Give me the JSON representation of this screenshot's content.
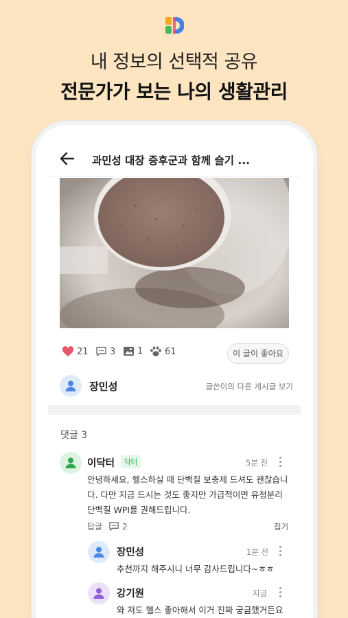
{
  "headline": {
    "line1": "내 정보의 선택적 공유",
    "line2": "전문가가 보는 나의 생활관리"
  },
  "topbar": {
    "title": "과민성 대장 증후군과 함께 슬기 ..."
  },
  "stats": {
    "likes": "21",
    "comments": "3",
    "images": "1",
    "paws": "61"
  },
  "like_post_button": "이 글이 좋아요",
  "author": {
    "name": "장민성",
    "more_posts_link": "글쓴이의 다른 게시글 보기"
  },
  "comments_header": "댓글 3",
  "comments": [
    {
      "name": "이닥터",
      "badge": "닥터",
      "time": "5분 전",
      "lines": [
        "안녕하세요, 헬스하실 때 단백질 보충제 드셔도 괜찮습니",
        "다. 다만 지금 드시는 것도 좋지만 가급적이면 유청분리",
        "단백질 WPI를 권해드립니다."
      ],
      "reply_label": "답글",
      "reply_count": "2",
      "fold_label": "접기"
    }
  ],
  "replies": [
    {
      "name": "장민성",
      "time": "1분 전",
      "text": "추천까지 해주시니 너무 감사드립니다~ㅎㅎ"
    },
    {
      "name": "강기원",
      "time": "지금",
      "text": "와 저도 헬스 좋아해서 이거 진짜 궁금했거든요"
    }
  ],
  "colors": {
    "background": "#fde5c2",
    "like_heart": "#e8556a",
    "doctor_badge": "#2fa84f"
  },
  "icons": [
    "app-logo-icon",
    "back-arrow-icon",
    "heart-icon",
    "comment-icon",
    "image-icon",
    "paw-icon",
    "person-icon",
    "more-vertical-icon"
  ]
}
